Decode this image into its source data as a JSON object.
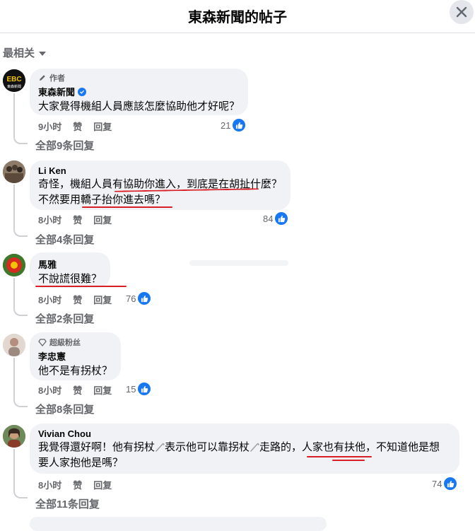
{
  "header": {
    "title": "東森新聞的帖子"
  },
  "sort": {
    "label": "最相关"
  },
  "comments": [
    {
      "badge": "作者",
      "name": "東森新聞",
      "lines": [
        "大家覺得機組人員應該怎麼協助他才好呢？"
      ],
      "time": "9小时",
      "like_label": "赞",
      "reply_label": "回复",
      "likes": "21",
      "replies": "全部9条回复",
      "avatar_text": "EBC",
      "avatar_subtext": "東森新聞"
    },
    {
      "name": "Li Ken",
      "lines": [
        "奇怪，機組人員有協助你進入，到底是在胡扯什麼？",
        "不然要用轎子抬你進去嗎？"
      ],
      "time": "8小时",
      "like_label": "赞",
      "reply_label": "回复",
      "likes": "84",
      "replies": "全部4条回复"
    },
    {
      "name": "馬雅",
      "lines": [
        "不說謊很難？"
      ],
      "time": "8小时",
      "like_label": "赞",
      "reply_label": "回复",
      "likes": "76",
      "replies": "全部2条回复"
    },
    {
      "badge": "超級粉丝",
      "name": "李忠憲",
      "lines": [
        "他不是有拐杖？"
      ],
      "time": "8小时",
      "like_label": "赞",
      "reply_label": "回复",
      "likes": "15",
      "replies": "全部8条回复"
    },
    {
      "name": "Vivian Chou",
      "line1_parts": [
        "我覺得還好啊！他有拐杖",
        "表示他可以靠拐杖",
        "走路的，人家也有扶他，不知道他是想"
      ],
      "line2": "要人家抱他是嗎？",
      "time": "8小时",
      "like_label": "赞",
      "reply_label": "回复",
      "likes": "74",
      "replies": "全部11条回复"
    }
  ],
  "colors": {
    "accent": "#1877f2",
    "annotation": "#d91f26",
    "bubble": "#f0f2f5",
    "meta": "#65676b"
  }
}
